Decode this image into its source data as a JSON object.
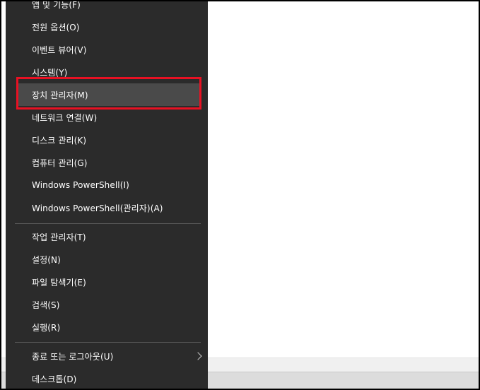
{
  "menu": {
    "items": [
      {
        "label": "앱 및 기능(F)"
      },
      {
        "label": "전원 옵션(O)"
      },
      {
        "label": "이벤트 뷰어(V)"
      },
      {
        "label": "시스템(Y)"
      },
      {
        "label": "장치 관리자(M)"
      },
      {
        "label": "네트워크 연결(W)"
      },
      {
        "label": "디스크 관리(K)"
      },
      {
        "label": "컴퓨터 관리(G)"
      },
      {
        "label": "Windows PowerShell(I)"
      },
      {
        "label": "Windows PowerShell(관리자)(A)"
      },
      {
        "label": "작업 관리자(T)"
      },
      {
        "label": "설정(N)"
      },
      {
        "label": "파일 탐색기(E)"
      },
      {
        "label": "검색(S)"
      },
      {
        "label": "실행(R)"
      },
      {
        "label": "종료 또는 로그아웃(U)",
        "submenu_icon": "chevron-right-icon"
      },
      {
        "label": "데스크톱(D)"
      }
    ],
    "hovered_item": "장치 관리자(M)",
    "annotation_color": "#e81123"
  },
  "colors": {
    "menu_background": "#2b2b2b",
    "menu_hover": "#4a4a4a",
    "menu_text": "#ffffff",
    "separator": "#5a5a5a"
  }
}
